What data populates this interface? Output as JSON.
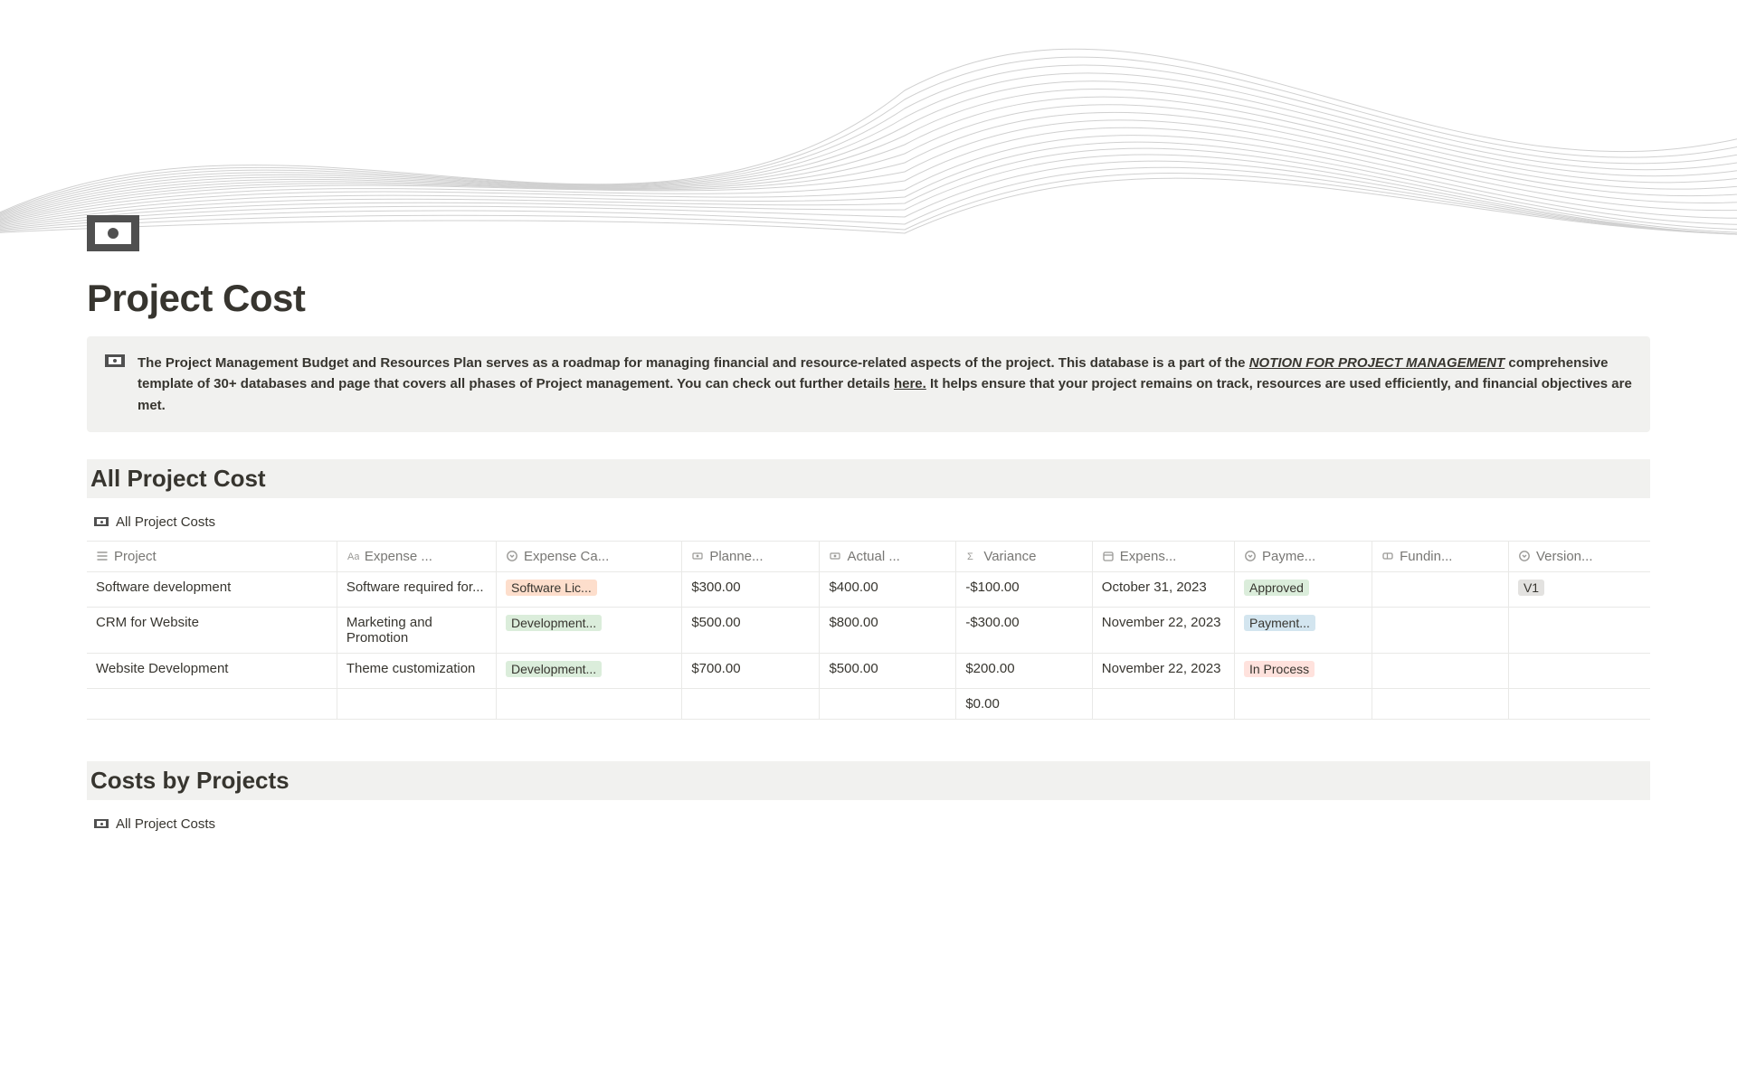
{
  "page": {
    "title": "Project Cost"
  },
  "callout": {
    "t1": "The Project Management Budget and Resources Plan serves as a roadmap for managing financial and resource-related aspects of the project. This  database is a part of the ",
    "link1": "NOTION FOR PROJECT MANAGEMENT",
    "t2": " comprehensive template of 30+ databases and page that covers all phases of Project management. You can check out further details ",
    "link2": "here.",
    "t3": " It helps ensure that your project remains on track, resources are used efficiently, and financial objectives are met."
  },
  "section1": {
    "heading": "All Project Cost",
    "view_tab": "All Project Costs"
  },
  "columns": {
    "project": "Project",
    "desc": "Expense ...",
    "cat": "Expense Ca...",
    "planned": "Planne...",
    "actual": "Actual ...",
    "variance": "Variance",
    "date": "Expens...",
    "payment": "Payme...",
    "funding": "Fundin...",
    "version": "Version..."
  },
  "rows": [
    {
      "project": "Software development",
      "desc": "Software required for...",
      "cat": "Software Lic...",
      "cat_color": "orange",
      "planned": "$300.00",
      "actual": "$400.00",
      "variance": "-$100.00",
      "date": "October 31, 2023",
      "payment": "Approved",
      "payment_color": "green",
      "version": "V1",
      "version_color": "gray"
    },
    {
      "project": "CRM for Website",
      "desc": "Marketing and Promotion",
      "cat": "Development...",
      "cat_color": "green",
      "planned": "$500.00",
      "actual": "$800.00",
      "variance": "-$300.00",
      "date": "November 22, 2023",
      "payment": "Payment...",
      "payment_color": "blue",
      "version": "",
      "version_color": ""
    },
    {
      "project": "Website Development",
      "desc": "Theme customization",
      "cat": "Development...",
      "cat_color": "green",
      "planned": "$700.00",
      "actual": "$500.00",
      "variance": "$200.00",
      "date": "November 22, 2023",
      "payment": "In Process",
      "payment_color": "red",
      "version": "",
      "version_color": ""
    }
  ],
  "footer": {
    "variance_total": "$0.00"
  },
  "section2": {
    "heading": "Costs by Projects",
    "view_tab": "All Project Costs"
  }
}
